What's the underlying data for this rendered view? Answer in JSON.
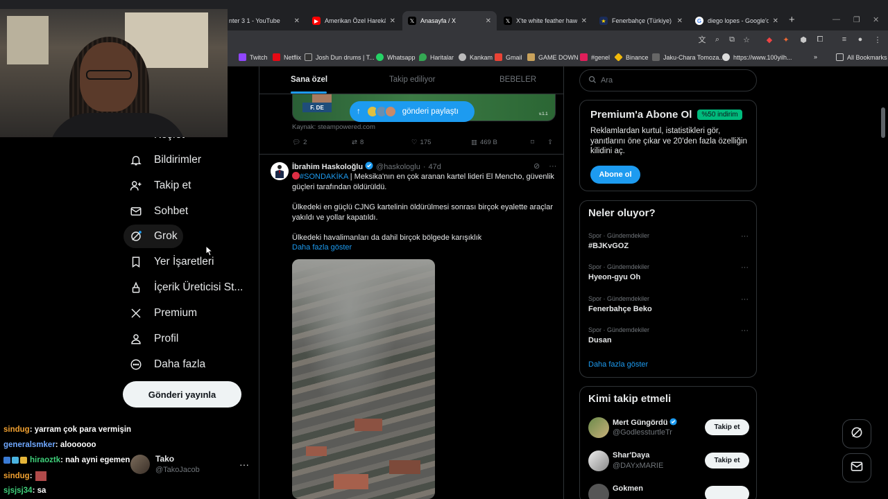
{
  "browser": {
    "tabs": [
      {
        "title": "nter 3 1 - YouTube",
        "icon": "youtube-icon"
      },
      {
        "title": "Amerikan Özel Harekâtyl",
        "icon": "youtube-icon"
      },
      {
        "title": "Anasayfa / X",
        "icon": "x-logo-icon"
      },
      {
        "title": "X'te white feather hawk t",
        "icon": "x-logo-icon"
      },
      {
        "title": "Fenerbahçe (Türkiye) - S",
        "icon": "fenerbahce-icon"
      },
      {
        "title": "diego lopes - Google'da a",
        "icon": "google-icon"
      }
    ],
    "bookmarks": [
      "Twitch",
      "Netflix",
      "Josh Dun drums | T...",
      "Whatsapp",
      "Haritalar",
      "Kankam",
      "Gmail",
      "GAME DOWN",
      "#genel",
      "Binance",
      "Jaku-Chara Tomoza...",
      "https://www.100yilh..."
    ],
    "all_bookmarks": "All Bookmarks"
  },
  "nav": {
    "partial_item": "Keşfet",
    "items": [
      "Bildirimler",
      "Takip et",
      "Sohbet",
      "Grok",
      "Yer İşaretleri",
      "İçerik Üreticisi St...",
      "Premium",
      "Profil",
      "Daha fazla"
    ],
    "post_button": "Gönderi yayınla",
    "account_name": "Tako",
    "account_handle": "@TakoJacob"
  },
  "feed": {
    "tabs": [
      "Sana özel",
      "Takip ediliyor",
      "BEBELER"
    ],
    "card_badge": "F. DE",
    "card_version": "v.1.1",
    "share_pill": "gönderi paylaştı",
    "source": "Kaynak: steampowered.com",
    "actions": {
      "replies": "2",
      "reposts": "8",
      "likes": "175",
      "views": "469 B"
    },
    "tweet": {
      "name": "İbrahim Haskoloğlu",
      "handle": "@haskologlu",
      "time": "47d",
      "hashtag": "#SONDAKİKA",
      "line1": " | Meksika'nın en çok aranan kartel lideri El Mencho, güvenlik güçleri tarafından öldürüldü.",
      "para2": "Ülkedeki en güçlü CJNG kartelinin öldürülmesi sonrası birçok eyalette araçlar yakıldı ve yollar kapatıldı.",
      "para3": "Ülkedeki havalimanları da dahil birçok bölgede karışıklık",
      "show_more": "Daha fazla göster"
    }
  },
  "right": {
    "search_placeholder": "Ara",
    "premium": {
      "title": "Premium'a Abone Ol",
      "discount": "%50 indirim",
      "desc": "Reklamlardan kurtul, istatistikleri gör, yanıtlarını öne çıkar ve 20'den fazla özelliğin kilidini aç.",
      "button": "Abone ol"
    },
    "trends_title": "Neler oluyor?",
    "trends": [
      {
        "category": "Spor · Gündemdekiler",
        "topic": "#BJKvGOZ"
      },
      {
        "category": "Spor · Gündemdekiler",
        "topic": "Hyeon-gyu Oh"
      },
      {
        "category": "Spor · Gündemdekiler",
        "topic": "Fenerbahçe Beko"
      },
      {
        "category": "Spor · Gündemdekiler",
        "topic": "Dusan"
      }
    ],
    "trends_more": "Daha fazla göster",
    "who_title": "Kimi takip etmeli",
    "who": [
      {
        "name": "Mert Güngördü",
        "handle": "@GodlessturtleTr",
        "button": "Takip et",
        "verified": true
      },
      {
        "name": "Shar'Daya",
        "handle": "@DAYxMARIE",
        "button": "Takip et",
        "verified": false
      }
    ],
    "who_partial": "Gokmen"
  },
  "chat": [
    {
      "user": "sindug",
      "message": " : yarram çok para vermişin",
      "color": "#f0a030"
    },
    {
      "user": "generalsmker",
      "message": " : aloooooo",
      "color": "#6fa8ff"
    },
    {
      "user": "hiraoztk",
      "message": " : nah ayni egemen",
      "color": "#3fd07a"
    },
    {
      "user": "sindug",
      "message": " : ",
      "color": "#f0a030"
    },
    {
      "user": "sjsjsj34",
      "message": " : sa",
      "color": "#3fd07a"
    }
  ],
  "colors": {
    "accent": "#1d9bf0",
    "premium_discount": "#00ba7c",
    "background": "#000000"
  }
}
